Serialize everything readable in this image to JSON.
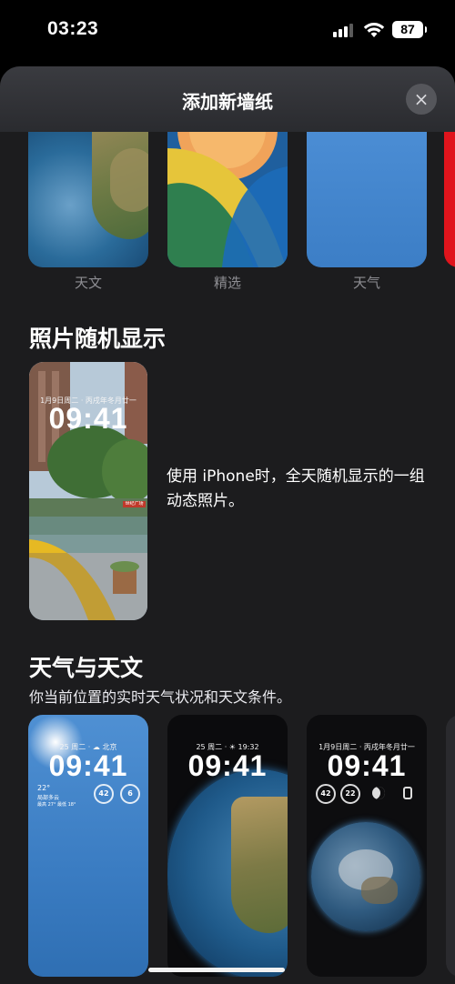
{
  "status_bar": {
    "time": "03:23",
    "battery": "87"
  },
  "sheet": {
    "title": "添加新墙纸",
    "close_icon": "×"
  },
  "top_row": {
    "labels": [
      "天文",
      "精选",
      "天气"
    ]
  },
  "photo_shuffle": {
    "title": "照片随机显示",
    "description": "使用 iPhone时，全天随机显示的一组动态照片。",
    "preview": {
      "date": "1月9日周二 · 丙戌年冬月廿一",
      "time": "09:41",
      "badge": "世纪广场"
    }
  },
  "weather_astronomy": {
    "title": "天气与天文",
    "subtitle": "你当前位置的实时天气状况和天文条件。",
    "cards": [
      {
        "date": "25 周二 · ☁ 北京",
        "time": "09:41",
        "widget1": "42",
        "widget2": "6",
        "weather": "22°",
        "weather_desc": "局部多云",
        "weather_range": "最高 27° 最低 18°"
      },
      {
        "date": "25 周二 · ☀ 19:32",
        "time": "09:41"
      },
      {
        "date": "1月9日周二 · 丙戌年冬月廿一",
        "time": "09:41",
        "widget1": "42",
        "widget2": "22"
      }
    ]
  }
}
